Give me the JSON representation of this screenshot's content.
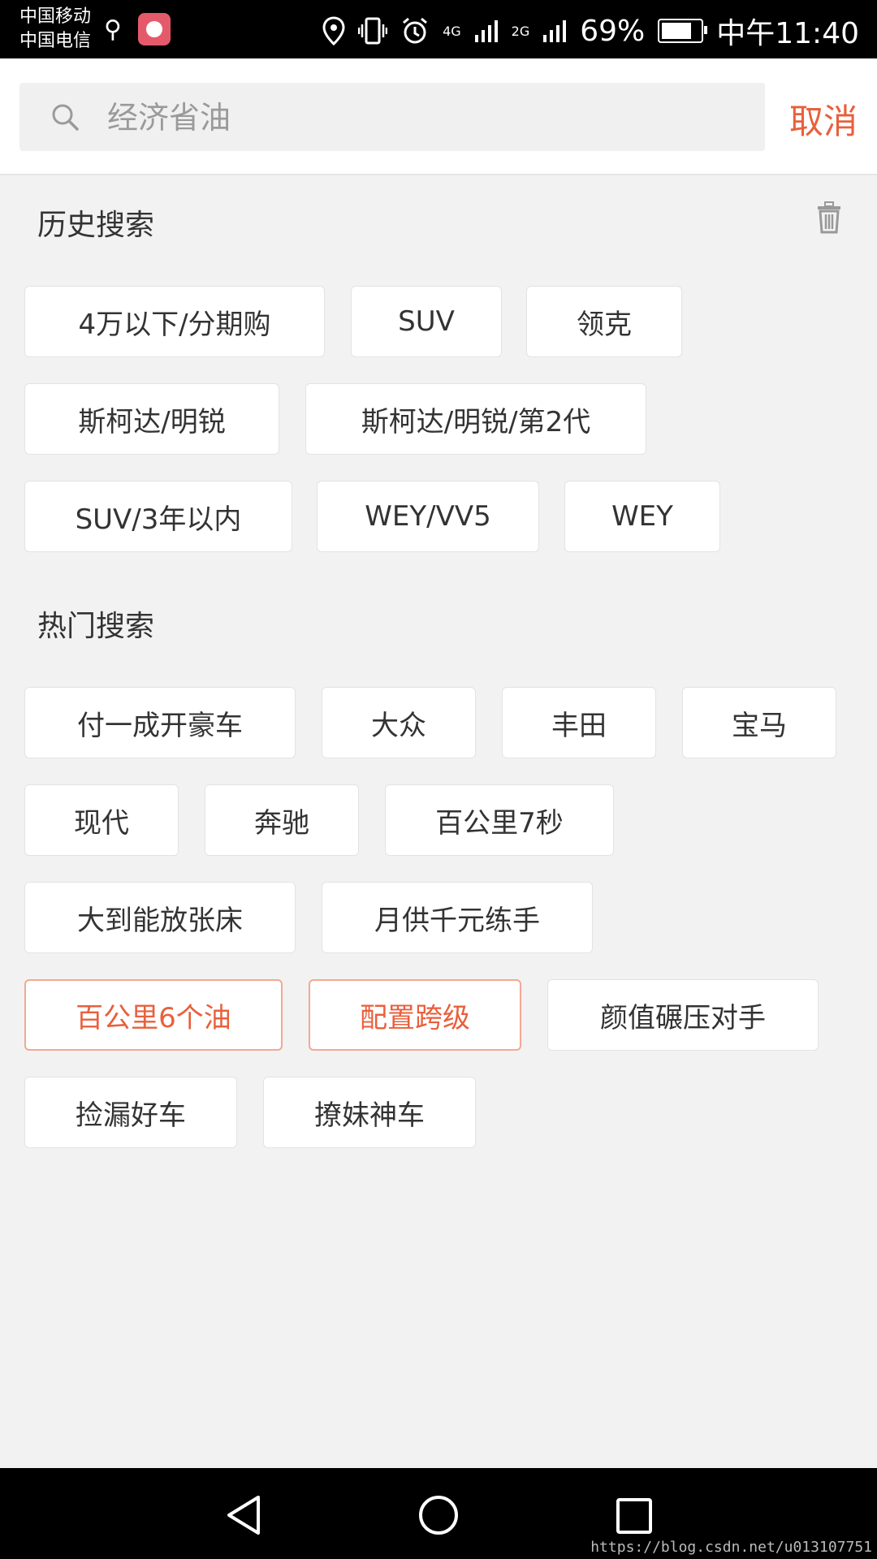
{
  "status_bar": {
    "carrier_1": "中国移动",
    "carrier_2": "中国电信",
    "network_1": "4G",
    "network_2": "2G",
    "battery": "69%",
    "time": "中午11:40",
    "icons": [
      "usb-icon",
      "app-icon",
      "location-icon",
      "vibrate-icon",
      "alarm-icon",
      "signal-icon",
      "battery-icon"
    ]
  },
  "search": {
    "placeholder": "经济省油",
    "cancel_label": "取消"
  },
  "history": {
    "title": "历史搜索",
    "items": [
      "4万以下/分期购",
      "SUV",
      "领克",
      "斯柯达/明锐",
      "斯柯达/明锐/第2代",
      "SUV/3年以内",
      "WEY/VV5",
      "WEY"
    ]
  },
  "hot": {
    "title": "热门搜索",
    "items": [
      "付一成开豪车",
      "大众",
      "丰田",
      "宝马",
      "现代",
      "奔驰",
      "百公里7秒",
      "大到能放张床",
      "月供千元练手",
      "百公里6个油",
      "配置跨级",
      "颜值碾压对手",
      "捡漏好车",
      "撩妹神车"
    ],
    "highlighted": [
      "百公里6个油",
      "配置跨级"
    ]
  },
  "colors": {
    "accent": "#e8603c",
    "highlight_border": "#f1a994",
    "background": "#f2f2f2"
  },
  "watermark": "https://blog.csdn.net/u013107751"
}
